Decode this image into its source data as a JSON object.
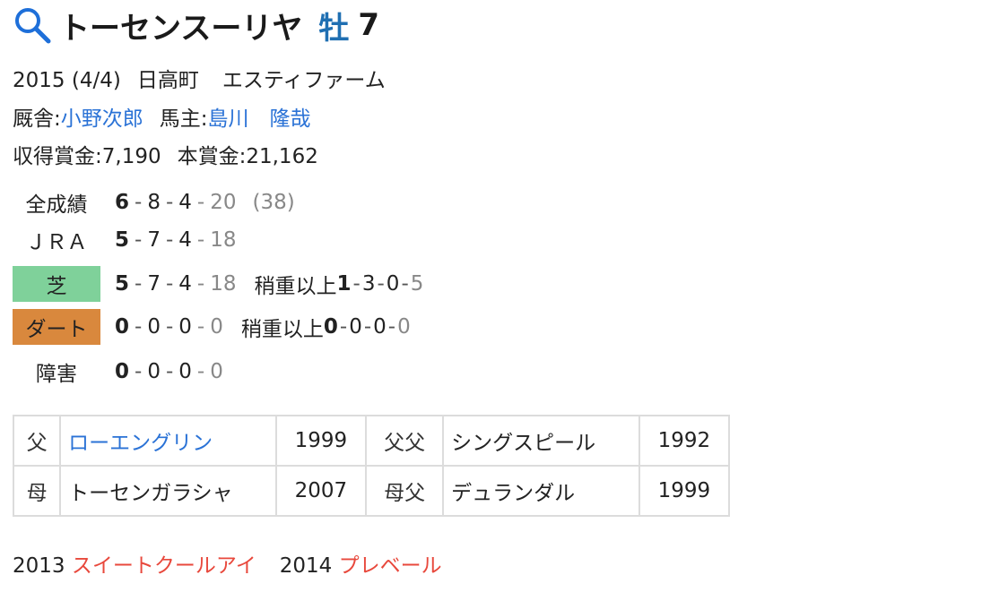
{
  "horse": {
    "name": "トーセンスーリヤ",
    "sex": "牡",
    "age": "7"
  },
  "profile": {
    "birth": "2015 (4/4)",
    "birthplace": "日高町",
    "breeder": "エスティファーム",
    "trainer_label": "厩舎:",
    "trainer": "小野次郎",
    "owner_label": "馬主:",
    "owner": "島川　隆哉",
    "earnings_label": "収得賞金:",
    "earnings": "7,190",
    "main_prize_label": "本賞金:",
    "main_prize": "21,162"
  },
  "records": {
    "overall": {
      "label": "全成績",
      "w": "6",
      "s": "8",
      "t": "4",
      "o": "20",
      "total": "(38)"
    },
    "jra": {
      "label": "ＪＲＡ",
      "w": "5",
      "s": "7",
      "t": "4",
      "o": "18"
    },
    "turf": {
      "label": "芝",
      "w": "5",
      "s": "7",
      "t": "4",
      "o": "18",
      "cond_label": "稍重以上",
      "cw": "1",
      "cs": "3",
      "ct": "0",
      "co": "5"
    },
    "dirt": {
      "label": "ダート",
      "w": "0",
      "s": "0",
      "t": "0",
      "o": "0",
      "cond_label": "稍重以上",
      "cw": "0",
      "cs": "0",
      "ct": "0",
      "co": "0"
    },
    "jump": {
      "label": "障害",
      "w": "0",
      "s": "0",
      "t": "0",
      "o": "0"
    }
  },
  "pedigree": {
    "sire_label": "父",
    "sire": "ローエングリン",
    "sire_year": "1999",
    "sire_sire_label": "父父",
    "sire_sire": "シングスピール",
    "sire_sire_year": "1992",
    "dam_label": "母",
    "dam": "トーセンガラシャ",
    "dam_year": "2007",
    "dam_sire_label": "母父",
    "dam_sire": "デュランダル",
    "dam_sire_year": "1999"
  },
  "progeny": [
    {
      "year": "2013",
      "name": "スイートクールアイ"
    },
    {
      "year": "2014",
      "name": "プレベール"
    }
  ],
  "colors": {
    "link": "#2a72d6",
    "sex": "#1f6fb2",
    "turf": "#7fd19a",
    "dirt": "#d9883d",
    "progeny": "#e8483c"
  },
  "icons": {
    "title": "search-icon"
  }
}
